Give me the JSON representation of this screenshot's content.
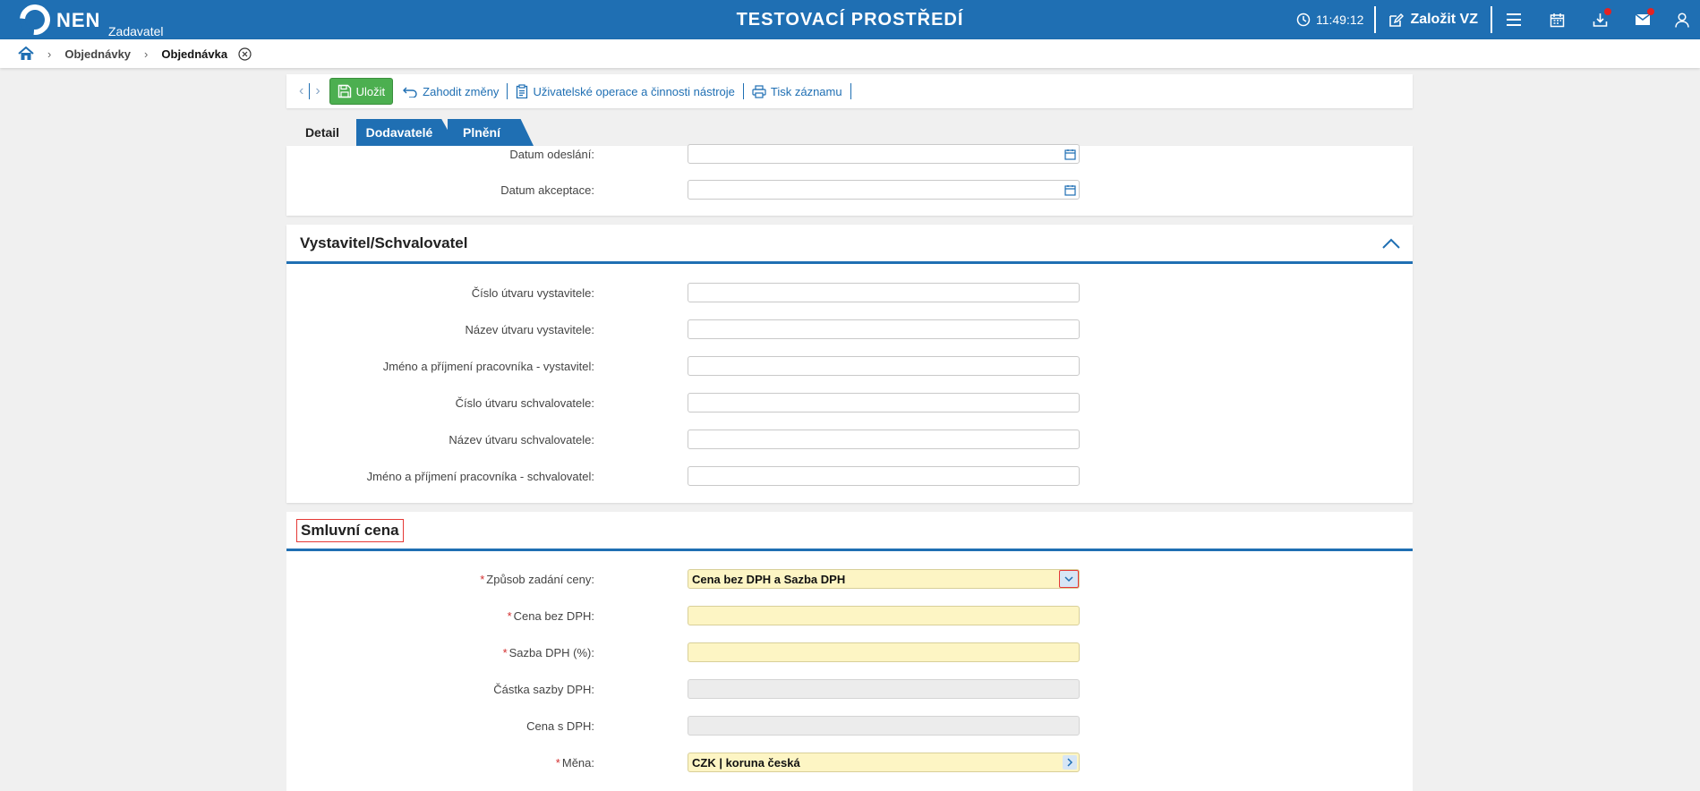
{
  "header": {
    "logo_text": "NEN",
    "logo_sub": "Zadavatel",
    "env_title": "TESTOVACÍ PROSTŘEDÍ",
    "clock": "11:49:12",
    "create_label": "Založit VZ"
  },
  "breadcrumb": {
    "items": [
      "Objednávky",
      "Objednávka"
    ]
  },
  "toolbar": {
    "save_label": "Uložit",
    "discard_label": "Zahodit změny",
    "ops_label": "Uživatelské operace a činnosti nástroje",
    "print_label": "Tisk záznamu"
  },
  "tabs": [
    "Detail",
    "Dodavatelé",
    "Plnění"
  ],
  "section1": {
    "rows": [
      {
        "label": "Datum odeslání:",
        "value": ""
      },
      {
        "label": "Datum akceptace:",
        "value": ""
      }
    ]
  },
  "section2": {
    "title": "Vystavitel/Schvalovatel",
    "rows": [
      {
        "label": "Číslo útvaru vystavitele:",
        "value": ""
      },
      {
        "label": "Název útvaru vystavitele:",
        "value": ""
      },
      {
        "label": "Jméno a příjmení pracovníka - vystavitel:",
        "value": ""
      },
      {
        "label": "Číslo útvaru schvalovatele:",
        "value": ""
      },
      {
        "label": "Název útvaru schvalovatele:",
        "value": ""
      },
      {
        "label": "Jméno a příjmení pracovníka - schvalovatel:",
        "value": ""
      }
    ]
  },
  "section3": {
    "title": "Smluvní cena",
    "rows": [
      {
        "label": "Způsob zadání ceny:",
        "value": "Cena bez DPH a Sazba DPH",
        "required": true
      },
      {
        "label": "Cena bez DPH:",
        "value": "",
        "required": true
      },
      {
        "label": "Sazba DPH (%):",
        "value": "",
        "required": true
      },
      {
        "label": "Částka sazby DPH:",
        "value": ""
      },
      {
        "label": "Cena s DPH:",
        "value": ""
      },
      {
        "label": "Měna:",
        "value": "CZK | koruna česká",
        "required": true
      }
    ]
  },
  "colors": {
    "brand": "#1f6fb3",
    "save": "#4caf50",
    "required_bg": "#fdf5c4",
    "highlight": "#e53935"
  }
}
